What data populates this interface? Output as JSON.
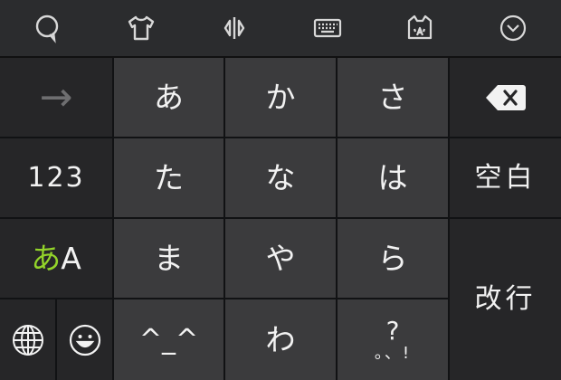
{
  "toolbar": {
    "icons": [
      "speech-bubble-icon",
      "shirt-icon",
      "cursor-move-icon",
      "keyboard-icon",
      "cat-face-icon",
      "chevron-down-circle-icon"
    ]
  },
  "keys": {
    "arrow": "→",
    "a": "あ",
    "ka": "か",
    "sa": "さ",
    "ta": "た",
    "na": "な",
    "ha": "は",
    "ma": "ま",
    "ya": "や",
    "ra": "ら",
    "face": "^_^",
    "wa": "わ",
    "punct_top": "?",
    "punct_bottom": "。、!",
    "num": "123",
    "mode_kana": "あ",
    "mode_latin": "A",
    "space": "空白",
    "enter": "改行"
  },
  "colors": {
    "toolbar_bg": "#2b2c2e",
    "key_main": "#3b3b3d",
    "key_side": "#262628",
    "accent_green": "#93d42a"
  }
}
